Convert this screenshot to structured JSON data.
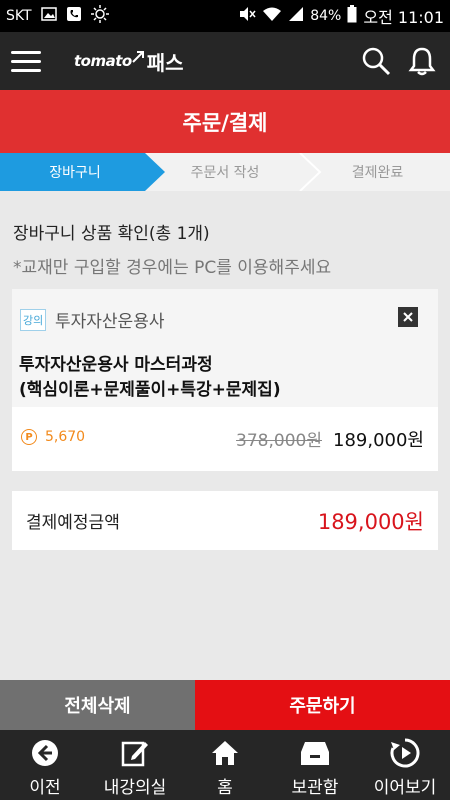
{
  "status_bar": {
    "carrier": "SKT",
    "battery": "84%",
    "time": "오전 11:01"
  },
  "app_header": {
    "logo_text_1": "tomato",
    "logo_text_2": "패스"
  },
  "title": "주문/결제",
  "steps": [
    {
      "label": "장바구니",
      "active": true
    },
    {
      "label": "주문서 작성",
      "active": false
    },
    {
      "label": "결제완료",
      "active": false
    }
  ],
  "cart": {
    "heading": "장바구니 상품 확인(총 1개)",
    "note": "*교재만 구입할 경우에는 PC를 이용해주세요",
    "item": {
      "badge": "강의",
      "category": "투자자산운용사",
      "name_line1": "투자자산운용사 마스터과정",
      "name_line2": "(핵심이론+문제풀이+특강+문제집)",
      "point_symbol": "P",
      "points": "5,670",
      "original_price": "378,000원",
      "sale_price": "189,000원"
    }
  },
  "total": {
    "label": "결제예정금액",
    "value": "189,000원"
  },
  "actions": {
    "delete_all": "전체삭제",
    "order": "주문하기"
  },
  "bottom_nav": [
    {
      "label": "이전",
      "icon": "back-icon"
    },
    {
      "label": "내강의실",
      "icon": "edit-icon"
    },
    {
      "label": "홈",
      "icon": "home-icon"
    },
    {
      "label": "보관함",
      "icon": "archive-icon"
    },
    {
      "label": "이어보기",
      "icon": "resume-play-icon"
    }
  ],
  "colors": {
    "header_bg": "#262626",
    "title_red": "#e03030",
    "step_active": "#1e9be0",
    "price_red": "#d8141c",
    "order_red": "#e40f13",
    "point_orange": "#f28a1c"
  }
}
